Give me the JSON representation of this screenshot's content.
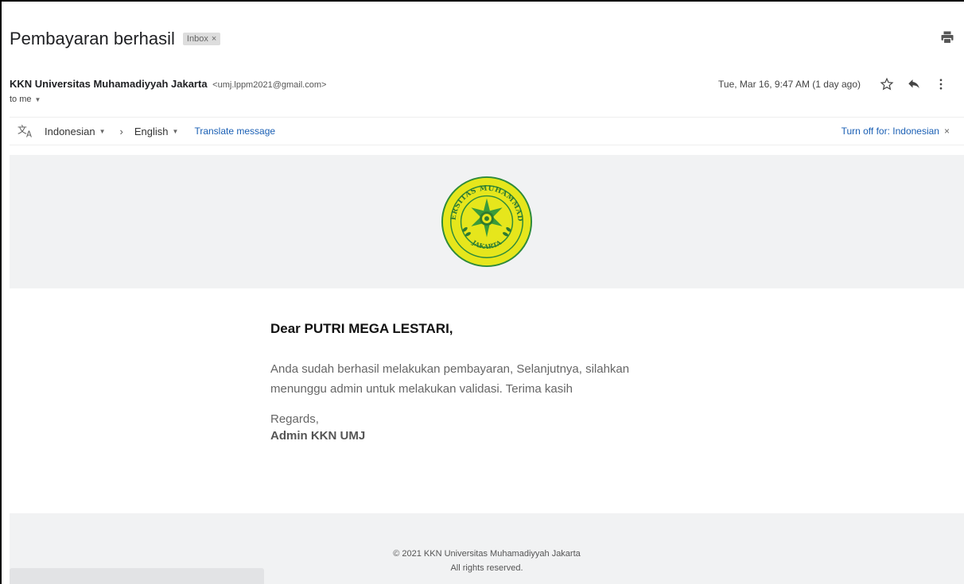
{
  "email": {
    "subject": "Pembayaran berhasil",
    "label_chip": "Inbox",
    "label_chip_close": "×",
    "sender_name": "KKN Universitas Muhamadiyyah Jakarta",
    "sender_email": "<umj.lppm2021@gmail.com>",
    "to_text": "to me",
    "date": "Tue, Mar 16, 9:47 AM (1 day ago)"
  },
  "translate": {
    "source_lang": "Indonesian",
    "target_lang": "English",
    "translate_link": "Translate message",
    "turn_off": "Turn off for: Indonesian",
    "close": "×"
  },
  "body": {
    "greeting": "Dear PUTRI MEGA LESTARI,",
    "message_line1": "Anda sudah berhasil melakukan pembayaran, Selanjutnya, silahkan",
    "message_line2": "menunggu admin untuk melakukan validasi. Terima kasih",
    "regards": "Regards,",
    "signature": "Admin KKN UMJ"
  },
  "footer": {
    "copyright": "© 2021 KKN Universitas Muhamadiyyah Jakarta",
    "rights": "All rights reserved."
  },
  "logo": {
    "top_text": "UNIVERSITAS MUHAMMADIYAH",
    "bottom_text": "JAKARTA",
    "outer_color": "#e8e81a",
    "inner_color": "#2e9a3c"
  },
  "icons": [
    "print-icon",
    "star-icon",
    "reply-icon",
    "more-vert-icon",
    "translate-icon",
    "chevron-right-icon",
    "caret-down-icon",
    "close-icon"
  ]
}
